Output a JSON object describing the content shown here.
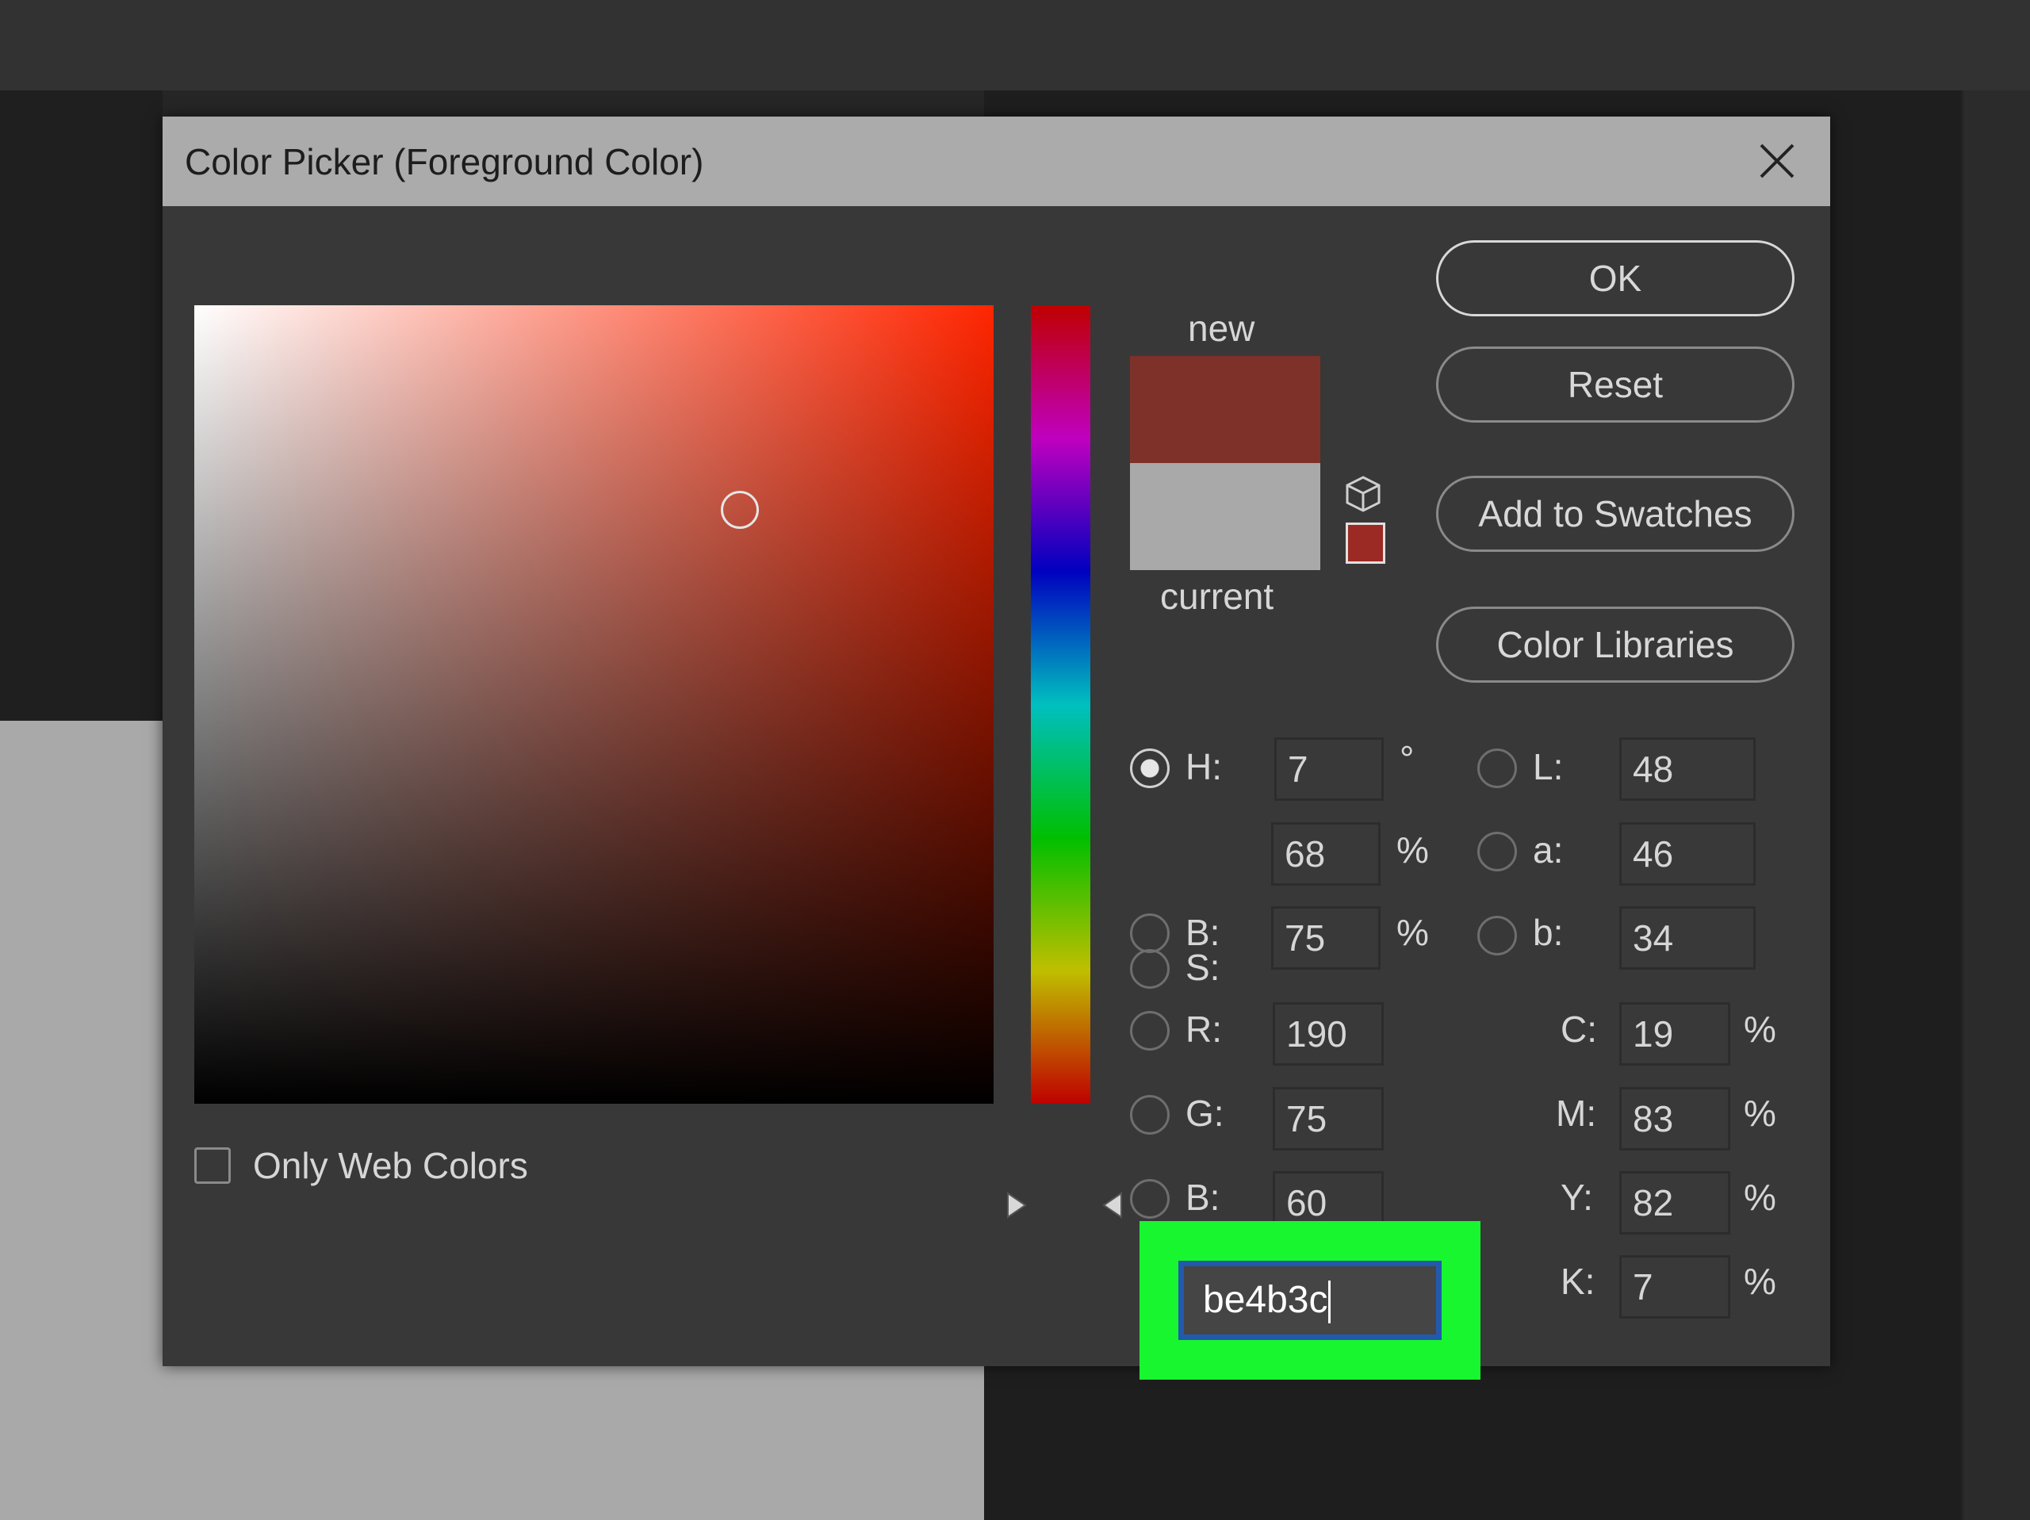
{
  "dialog": {
    "title": "Color Picker (Foreground Color)"
  },
  "preview": {
    "new_label": "new",
    "current_label": "current",
    "new_color": "#7e3128",
    "current_color": "#a9a9a9"
  },
  "buttons": {
    "ok": "OK",
    "reset": "Reset",
    "add_to_swatches": "Add to Swatches",
    "color_libraries": "Color Libraries"
  },
  "hsb": {
    "h_label": "H:",
    "h_value": "7",
    "h_unit": "°",
    "s_label": "S:",
    "s_value": "68",
    "s_unit": "%",
    "b_label": "B:",
    "b_value": "75",
    "b_unit": "%"
  },
  "rgb": {
    "r_label": "R:",
    "r_value": "190",
    "g_label": "G:",
    "g_value": "75",
    "b_label": "B:",
    "b_value": "60"
  },
  "lab": {
    "l_label": "L:",
    "l_value": "48",
    "a_label": "a:",
    "a_value": "46",
    "b_label": "b:",
    "b_value": "34"
  },
  "cmyk": {
    "c_label": "C:",
    "c_value": "19",
    "m_label": "M:",
    "m_value": "83",
    "y_label": "Y:",
    "y_value": "82",
    "k_label": "K:",
    "k_value": "7",
    "unit": "%"
  },
  "hex": {
    "value": "be4b3c"
  },
  "options": {
    "only_web_colors": "Only Web Colors"
  },
  "colors": {
    "highlight": "#18f630",
    "hex_field_border": "#2359ad"
  }
}
